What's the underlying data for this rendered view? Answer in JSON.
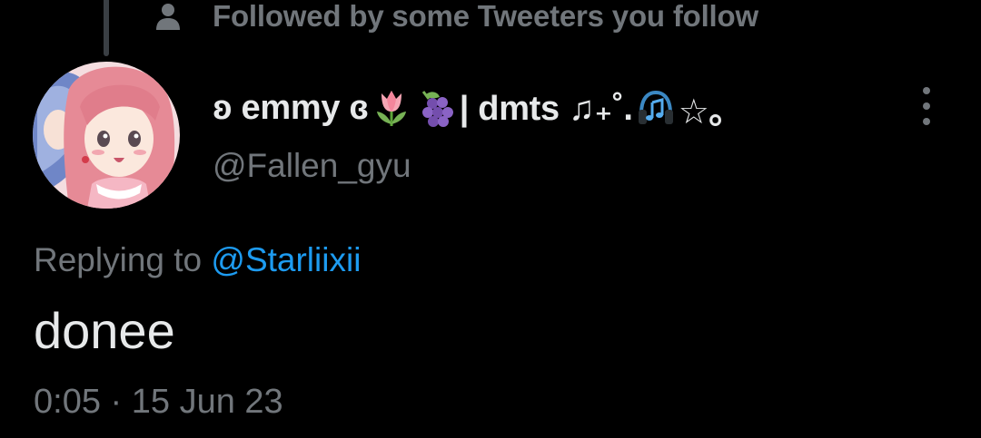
{
  "social_context": {
    "icon": "person-icon",
    "text": "Followed by some Tweeters you follow"
  },
  "author": {
    "display_name_prefix": "ʚ emmy ɞ",
    "emoji_1": "tulip",
    "emoji_2": "grapes",
    "display_name_suffix": "| dmts ♫₊˚.",
    "emoji_3": "headphones",
    "display_name_end": "☆｡",
    "handle": "@Fallen_gyu",
    "avatar": "anime-girl-avatar"
  },
  "reply": {
    "label": "Replying to",
    "mention": "@Starliixii"
  },
  "tweet": {
    "text": "donee",
    "time": "0:05",
    "separator": "·",
    "date": "15 Jun 23"
  },
  "colors": {
    "background": "#000000",
    "primary_text": "#e7e9ea",
    "secondary_text": "#71767b",
    "accent": "#1d9bf0"
  }
}
